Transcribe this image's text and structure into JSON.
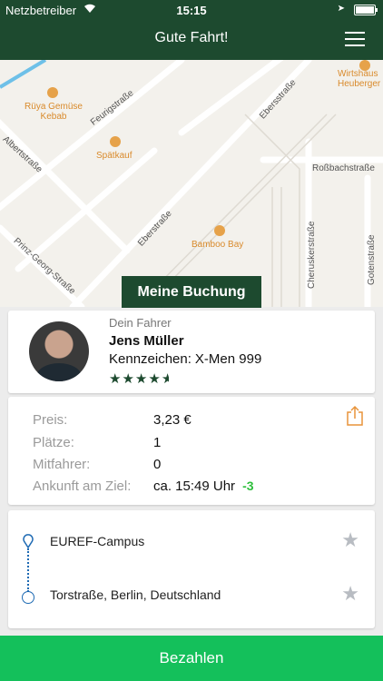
{
  "status_bar": {
    "carrier": "Netzbetreiber",
    "time": "15:15"
  },
  "header": {
    "title": "Gute Fahrt!",
    "menu_icon": "hamburger-icon"
  },
  "map": {
    "streets": [
      "Albertstraße",
      "Feurigstraße",
      "Eberstraße",
      "Ebersstraße",
      "Roßbachstraße",
      "Prinz-Georg-Straße",
      "Cheruskerstraße",
      "Gotenstraße"
    ],
    "pois": [
      "Rüya Gemüse Kebab",
      "Spätkauf",
      "Bamboo Bay",
      "Wirtshaus Heuberger"
    ]
  },
  "booking_tab": "Meine Buchung",
  "driver": {
    "caption": "Dein Fahrer",
    "name": "Jens Müller",
    "plate_label": "Kennzeichen:",
    "plate_value": "X-Men 999",
    "rating": 4.5
  },
  "info": {
    "rows": [
      {
        "label": "Preis:",
        "value": "3,23 €"
      },
      {
        "label": "Plätze:",
        "value": "1"
      },
      {
        "label": "Mitfahrer:",
        "value": "0"
      },
      {
        "label": "Ankunft am Ziel:",
        "value": "ca. 15:49 Uhr",
        "delta": "-3"
      }
    ],
    "share_icon": "share-icon"
  },
  "route": {
    "from": "EUREF-Campus",
    "to": "Torstraße, Berlin, Deutschland"
  },
  "pay_button": "Bezahlen",
  "colors": {
    "header": "#1d4a2f",
    "pay": "#14c05b",
    "delta": "#2fbf3d"
  }
}
